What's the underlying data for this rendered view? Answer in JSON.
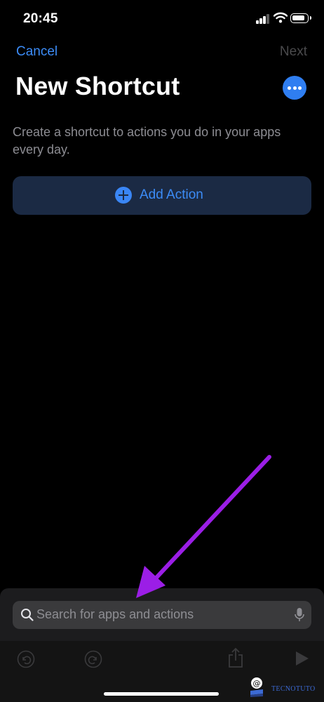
{
  "status_bar": {
    "time": "20:45"
  },
  "nav": {
    "cancel_label": "Cancel",
    "next_label": "Next"
  },
  "page": {
    "title": "New Shortcut",
    "description": "Create a shortcut to actions you do in your apps every day.",
    "add_action_label": "Add Action"
  },
  "search": {
    "placeholder": "Search for apps and actions"
  },
  "toolbar": {
    "items": [
      "undo-icon",
      "redo-icon",
      "share-icon",
      "play-icon"
    ]
  },
  "watermark": {
    "text": "TECNOTUTO"
  },
  "colors": {
    "accent": "#3c8cf7",
    "annotation_arrow": "#9b1ee6",
    "background": "#000000",
    "add_action_bg": "#1b2a44"
  }
}
